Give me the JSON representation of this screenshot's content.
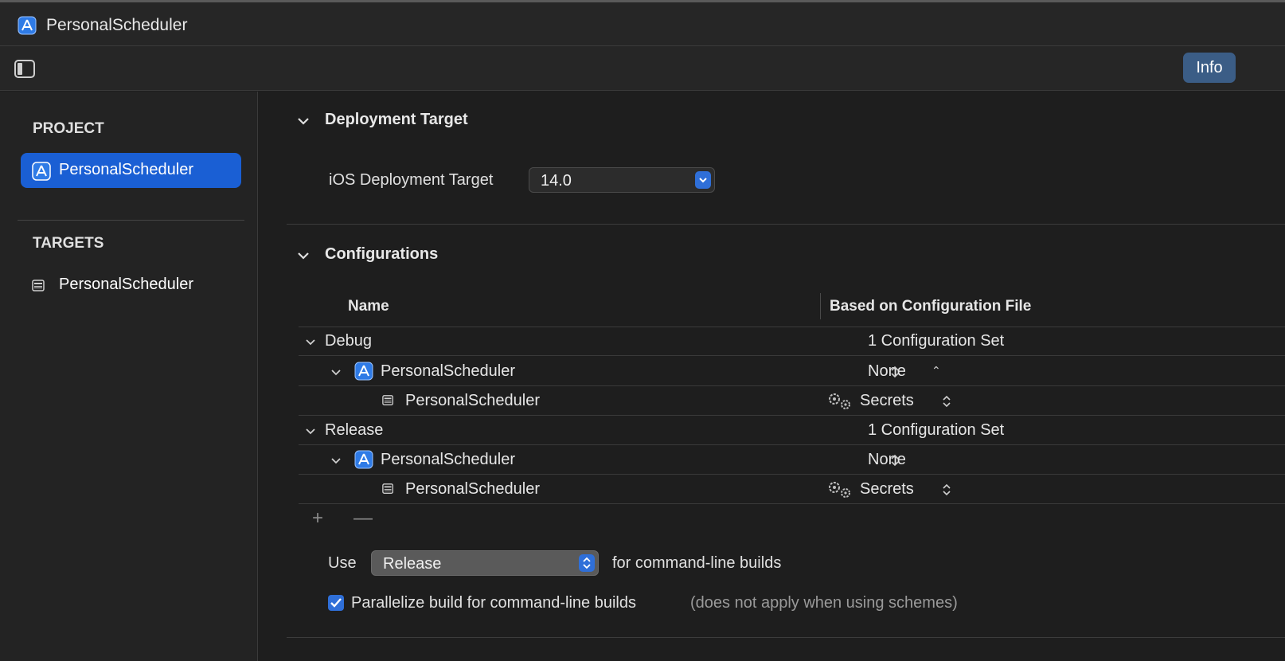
{
  "window": {
    "title": "PersonalScheduler"
  },
  "toolbar": {
    "info_label": "Info"
  },
  "sidebar": {
    "project_heading": "PROJECT",
    "project_item": "PersonalScheduler",
    "targets_heading": "TARGETS",
    "target_item": "PersonalScheduler"
  },
  "deployment": {
    "section_title": "Deployment Target",
    "ios_label": "iOS Deployment Target",
    "ios_value": "14.0"
  },
  "configurations": {
    "section_title": "Configurations",
    "col_name": "Name",
    "col_based_on": "Based on Configuration File",
    "rows": [
      {
        "name": "Debug",
        "based": "1 Configuration Set"
      },
      {
        "name": "PersonalScheduler",
        "based": "None"
      },
      {
        "name": "PersonalScheduler",
        "based": "Secrets"
      },
      {
        "name": "Release",
        "based": "1 Configuration Set"
      },
      {
        "name": "PersonalScheduler",
        "based": "None"
      },
      {
        "name": "PersonalScheduler",
        "based": "Secrets"
      }
    ],
    "add_label": "+",
    "remove_label": "—",
    "use_label": "Use",
    "use_value": "Release",
    "use_suffix": "for command-line builds",
    "parallelize_label": "Parallelize build for command-line builds",
    "parallelize_note": "(does not apply when using schemes)",
    "parallelize_checked": true
  },
  "icons": {
    "app": "app-project-icon",
    "target": "target-icon",
    "gear": "gear-icon",
    "sidebar_toggle": "sidebar-toggle-icon"
  },
  "colors": {
    "accent": "#1a5fd4",
    "info_button": "#3b5d86"
  }
}
